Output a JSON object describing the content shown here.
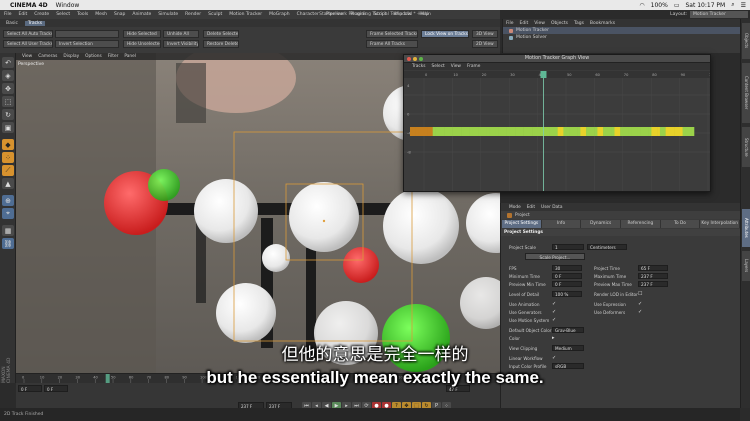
{
  "menubar": {
    "app_name": "CINEMA 4D",
    "items": [
      "Window"
    ],
    "battery": "100%",
    "clock": "Sat 10:17 PM",
    "window_title": "Starter work Recording Tutorial Temp.c4d * - Main"
  },
  "c4d_menu": [
    "File",
    "Edit",
    "Create",
    "Select",
    "Tools",
    "Mesh",
    "Snap",
    "Animate",
    "Simulate",
    "Render",
    "Sculpt",
    "Motion Tracker",
    "MoGraph",
    "Character",
    "Pipeline",
    "Plugins",
    "Script",
    "Window",
    "Help"
  ],
  "layout": {
    "label": "Layout:",
    "value": "Motion Tracker"
  },
  "mode_tabs": [
    "Basic",
    "Tracks"
  ],
  "commands": {
    "select_all_auto": "Select All Auto Tracks",
    "select_all_user": "Select All User Tracks",
    "invert_selection": "Invert Selection",
    "hide_selected": "Hide Selected",
    "hide_unselected": "Hide Unselected",
    "unhide_all": "Unhide All",
    "invert_visibility": "Invert Visibility",
    "delete_selected": "Delete Selected",
    "restore_deleted": "Restore Deleted",
    "frame_selected": "Frame Selected Tracks",
    "frame_all": "Frame All Tracks",
    "lock_view": "Lock View on Tracks",
    "view_3d": "3D View",
    "view_2d": "2D View"
  },
  "object_manager": {
    "menu": [
      "File",
      "Edit",
      "View",
      "Objects",
      "Tags",
      "Bookmarks"
    ],
    "items": [
      "Motion Tracker",
      "Motion Solver"
    ]
  },
  "right_tabs": [
    "Objects",
    "Content Browser",
    "Structure",
    "Attributes",
    "Layers"
  ],
  "viewport": {
    "menu": [
      "View",
      "Cameras",
      "Display",
      "Options",
      "Filter",
      "Panel"
    ],
    "label": "Perspective"
  },
  "graph_view": {
    "title": "Motion Tracker Graph View",
    "menu": [
      "Tracks",
      "Select",
      "View",
      "Frame"
    ],
    "frame_ticks": [
      "0",
      "10",
      "20",
      "30",
      "40",
      "50",
      "60",
      "70",
      "80",
      "90",
      "100"
    ],
    "current_frame": "47",
    "y_labels": [
      "4",
      "0",
      "-4",
      "-8"
    ]
  },
  "timeline": {
    "ticks": [
      "0",
      "10",
      "20",
      "30",
      "40",
      "50",
      "60",
      "70",
      "80",
      "90",
      "100",
      "110",
      "120",
      "130",
      "140",
      "150",
      "160",
      "170",
      "180",
      "190",
      "200",
      "210",
      "220",
      "230"
    ],
    "current_frame": "47 F",
    "start_field": "0 F",
    "min_field": "0 F",
    "end_field": "237 F",
    "max_field": "237 F"
  },
  "attributes": {
    "menu": [
      "Mode",
      "Edit",
      "User Data"
    ],
    "object_name": "Project",
    "tabs": [
      "Project Settings",
      "Info",
      "Dynamics",
      "Referencing",
      "To Do",
      "Key Interpolation"
    ],
    "section": "Project Settings",
    "project_scale_label": "Project Scale",
    "project_scale_value": "1",
    "project_scale_unit": "Centimeters",
    "scale_button": "Scale Project...",
    "fps_label": "FPS",
    "fps_value": "30",
    "project_time_label": "Project Time",
    "project_time_value": "65 F",
    "min_time_label": "Minimum Time",
    "min_time_value": "0 F",
    "max_time_label": "Maximum Time",
    "max_time_value": "237 F",
    "prev_min_label": "Preview Min Time",
    "prev_min_value": "0 F",
    "prev_max_label": "Preview Max Time",
    "prev_max_value": "237 F",
    "lod_label": "Level of Detail",
    "lod_value": "100 %",
    "render_lod_label": "Render LOD in Editor",
    "use_animation": "Use Animation",
    "use_expression": "Use Expression",
    "use_generators": "Use Generators",
    "use_deformers": "Use Deformers",
    "use_motion_system": "Use Motion System",
    "default_color_label": "Default Object Color",
    "default_color_value": "Gray-Blue",
    "color_label": "Color",
    "view_clipping_label": "View Clipping",
    "view_clipping_value": "Medium",
    "linear_workflow": "Linear Workflow",
    "input_color_label": "Input Color Profile",
    "input_color_value": "sRGB"
  },
  "status": "2D Track Finished",
  "subtitles": {
    "zh": "但他的意思是完全一样的",
    "en": "but he essentially mean exactly the same."
  },
  "colors": {
    "accent": "#5e6d84",
    "track_green": "#9bd24a",
    "track_yellow": "#e8d22a",
    "track_orange": "#c7801e",
    "tool_orange": "#d7922e"
  }
}
